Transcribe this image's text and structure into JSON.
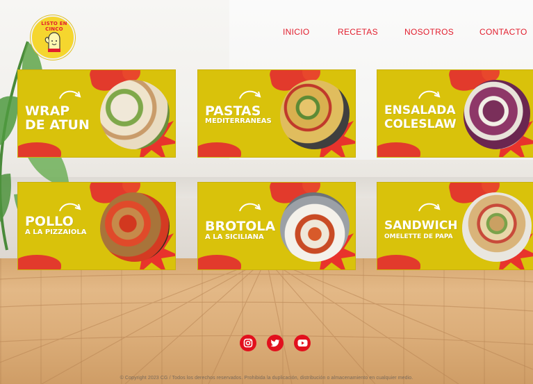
{
  "brand": {
    "logo_text": "LISTO EN CINCO",
    "primary_color": "#e21d2d",
    "yellow": "#d9c20b"
  },
  "nav": {
    "items": [
      {
        "label": "INICIO"
      },
      {
        "label": "RECETAS"
      },
      {
        "label": "NOSOTROS"
      },
      {
        "label": "CONTACTO"
      }
    ]
  },
  "recipes": [
    {
      "line1": "WRAP",
      "line2": "DE ATUN"
    },
    {
      "line1": "PASTAS",
      "line2": "MEDITERRANEAS"
    },
    {
      "line1": "ENSALADA",
      "line2": "COLESLAW"
    },
    {
      "line1": "POLLO",
      "line2": "A LA PIZZAIOLA"
    },
    {
      "line1": "BROTOLA",
      "line2": "A LA SICILIANA"
    },
    {
      "line1": "SANDWICH",
      "line2": "OMELETTE DE PAPA"
    }
  ],
  "social": [
    {
      "icon": "instagram-icon"
    },
    {
      "icon": "twitter-icon"
    },
    {
      "icon": "youtube-icon"
    }
  ],
  "footer": {
    "text": "© Copyright 2023 CG / Todos los derechos reservados. Prohibida la duplicación, distribución o almacenamiento en cualquier medio."
  }
}
